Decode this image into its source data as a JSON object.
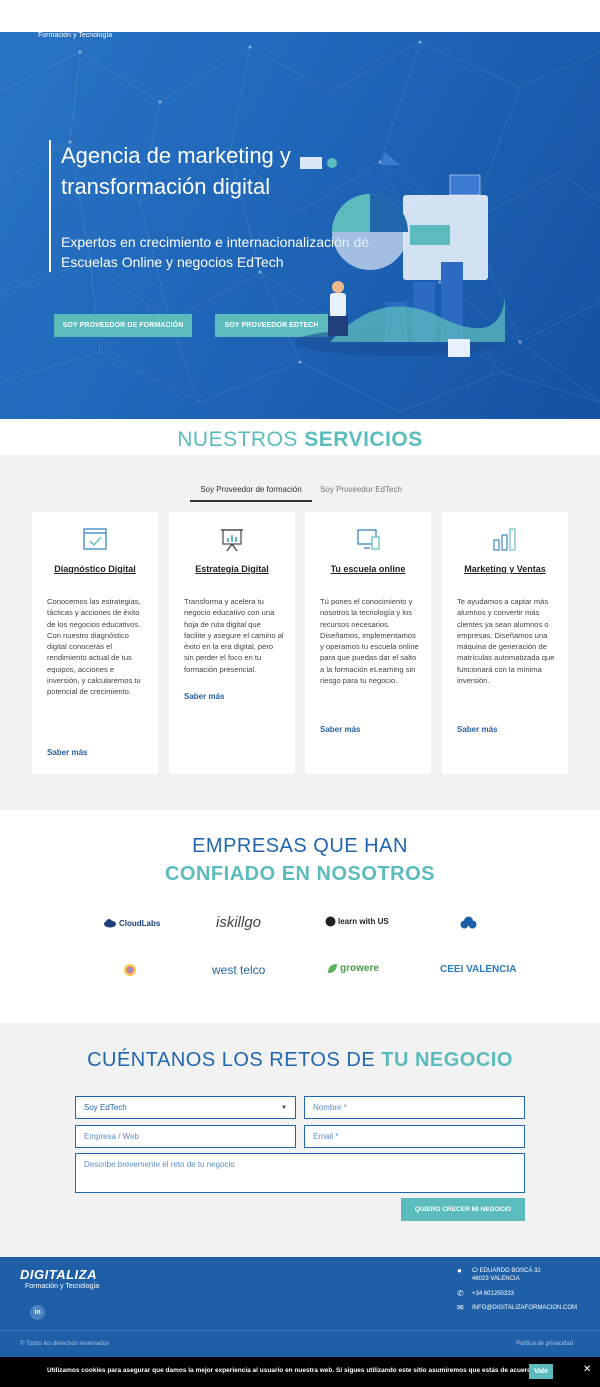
{
  "hero": {
    "tagline": "Formación y Tecnología",
    "title": "Agencia de marketing y transformación digital",
    "subtitle": "Expertos en crecimiento e internacionalización de Escuelas Online y negocios EdTech",
    "btn_training": "SOY PROVEEDOR DE FORMACIÓN",
    "btn_edtech": "SOY PROVEEDOR EDTECH"
  },
  "services": {
    "title_light": "NUESTROS",
    "title_bold": "SERVICIOS",
    "tabs": [
      "Soy Proveedor de formación",
      "Soy Proveedor EdTech"
    ],
    "cards": [
      {
        "title": "Diagnóstico Digital",
        "icon": "browser-check-icon",
        "text": "Conocemos las estrategias, tácticas y acciones de éxito de los negocios educativos. Con nuestro diagnóstico digital conocerás el rendimiento actual de tus equipos, acciones e inversión, y calcularemos tu potencial de crecimiento.",
        "link": "Saber más"
      },
      {
        "title": "Estrategia Digital",
        "icon": "presentation-board-icon",
        "text": "Transforma y acelera tu negocio educativo con una hoja de ruta digital que facilite y asegure el camino al éxito en la era digital, pero sin perder el foco en tu formación presencial.",
        "link": "Saber más"
      },
      {
        "title": "Tu escuela online",
        "icon": "devices-icon",
        "text": "Tú pones el conocimiento y nosotros la tecnología y los recursos necesarios. Diseñamos, implementamos y operamos tu escuela online para que puedas dar el salto a la formación eLearning sin riesgo para tu negocio.",
        "link": "Saber más"
      },
      {
        "title": "Marketing y Ventas",
        "icon": "bar-chart-icon",
        "text": "Te ayudamos a captar más alumnos y convertir más clientes ya sean alumnos o empresas. Diseñamos una máquina de generación de matrículas automatizada que funcionará con la mínima inversión.",
        "link": "Saber más"
      }
    ]
  },
  "clients": {
    "title_line1": "EMPRESAS QUE HAN",
    "title_line2": "CONFIADO EN NOSOTROS",
    "logos": [
      "CloudLabs",
      "iskillgo",
      "learn with US",
      "",
      "",
      "west telco",
      "growere",
      "CEEI VALENCIA"
    ]
  },
  "contact": {
    "title_light": "CUÉNTANOS LOS RETOS DE",
    "title_bold": "TU NEGOCIO",
    "select_value": "Soy EdTech",
    "name_placeholder": "Nombre *",
    "company_placeholder": "Empresa / Web",
    "email_placeholder": "Email *",
    "message_placeholder": "Describe brevemente el reto de tu negocio",
    "submit": "QUIERO CRECER MI NEGOCIO"
  },
  "footer": {
    "logo": "DIGITALIZA",
    "logo_sub": "Formación y Tecnología",
    "social": "in",
    "address_line1": "C/ EDUARDO BOSCÁ 32",
    "address_line2": "46023 VALENCIA",
    "phone": "+34 601250333",
    "email": "INFO@DIGITALIZAFORMACION.COM",
    "copyright": "© Todos los derechos reservados",
    "privacy": "Política de privacidad"
  },
  "cookie": {
    "text": "Utilizamos cookies para asegurar que damos la mejor experiencia al usuario en nuestra web. Si sigues utilizando este sitio asumiremos que estás de acuerdo.",
    "accept": "Vale",
    "close": "✕"
  },
  "colors": {
    "primary_blue": "#2266ad",
    "teal": "#5cbcbd",
    "footer_blue": "#1e5fa8"
  }
}
